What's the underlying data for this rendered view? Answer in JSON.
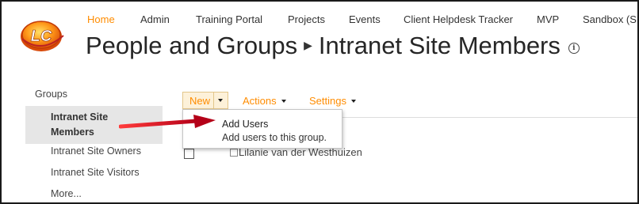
{
  "logo": {
    "text": "LC"
  },
  "topnav": {
    "items": [
      {
        "label": "Home",
        "active": true
      },
      {
        "label": "Admin"
      },
      {
        "label": "Training Portal"
      },
      {
        "label": "Projects"
      },
      {
        "label": "Events"
      },
      {
        "label": "Client Helpdesk Tracker"
      },
      {
        "label": "MVP"
      },
      {
        "label": "Sandbox (SP"
      }
    ]
  },
  "title": {
    "section": "People and Groups",
    "page": "Intranet Site Members"
  },
  "sidebar": {
    "heading": "Groups",
    "items": [
      {
        "label": "Intranet Site Members",
        "selected": true
      },
      {
        "label": "Intranet Site Owners"
      },
      {
        "label": "Intranet Site Visitors"
      },
      {
        "label": "More..."
      }
    ]
  },
  "toolbar": {
    "new_label": "New",
    "actions_label": "Actions",
    "settings_label": "Settings"
  },
  "dropdown": {
    "item_title": "Add Users",
    "item_description": "Add users to this group."
  },
  "list": {
    "rows": [
      {
        "name": "Lilanie van der Westhuizen"
      }
    ]
  },
  "colors": {
    "accent": "#ff8c00",
    "arrow": "#c8102e",
    "selected_bg": "#e6e6e6"
  }
}
